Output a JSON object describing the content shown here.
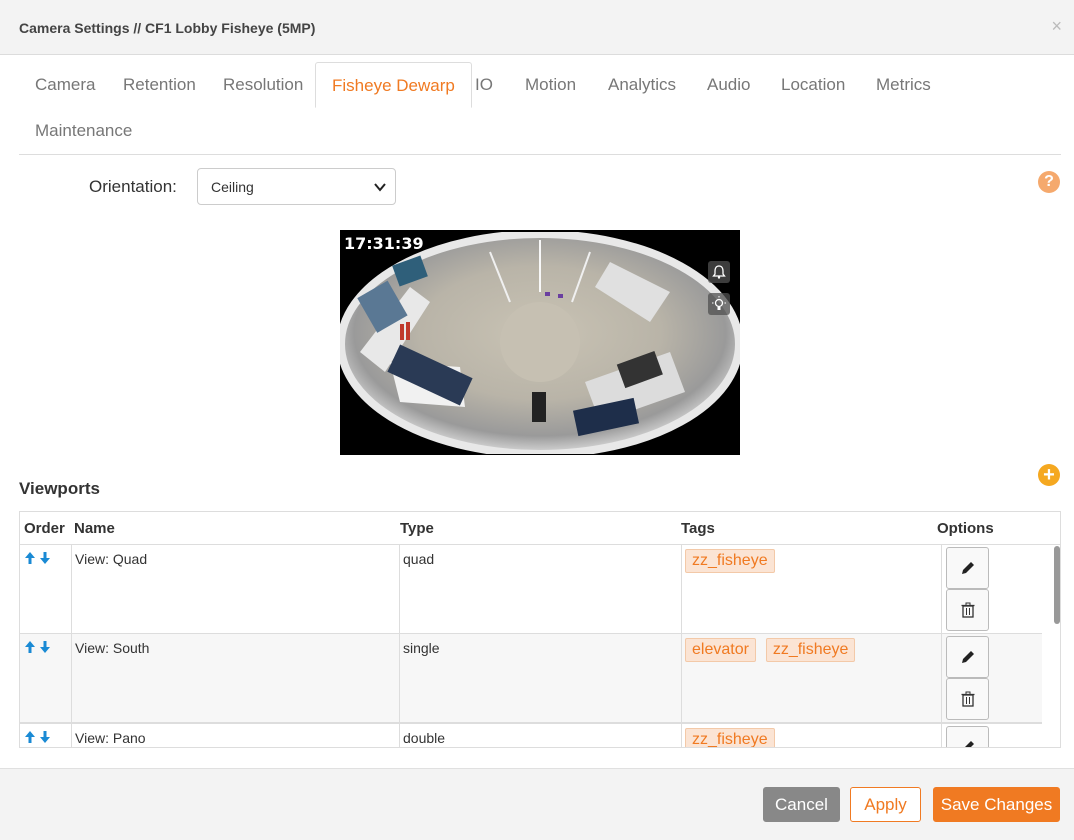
{
  "dialog": {
    "title": "Camera Settings // CF1 Lobby Fisheye (5MP)",
    "close_glyph": "×"
  },
  "tabs": [
    {
      "label": "Camera"
    },
    {
      "label": "Retention"
    },
    {
      "label": "Resolution"
    },
    {
      "label": "Fisheye Dewarp",
      "active": true
    },
    {
      "label": "IO"
    },
    {
      "label": "Motion"
    },
    {
      "label": "Analytics"
    },
    {
      "label": "Audio"
    },
    {
      "label": "Location"
    },
    {
      "label": "Metrics"
    },
    {
      "label": "Maintenance"
    }
  ],
  "orientation": {
    "label": "Orientation:",
    "value": "Ceiling"
  },
  "help_glyph": "?",
  "preview": {
    "timestamp": "17:31:39"
  },
  "viewports": {
    "title": "Viewports",
    "add_glyph": "+",
    "columns": {
      "order": "Order",
      "name": "Name",
      "type": "Type",
      "tags": "Tags",
      "options": "Options"
    },
    "rows": [
      {
        "name": "View: Quad",
        "type": "quad",
        "tags": [
          "zz_fisheye"
        ]
      },
      {
        "name": "View: South",
        "type": "single",
        "tags": [
          "elevator",
          "zz_fisheye"
        ]
      },
      {
        "name": "View: Pano",
        "type": "double",
        "tags": [
          "zz_fisheye"
        ]
      }
    ]
  },
  "footer": {
    "cancel": "Cancel",
    "apply": "Apply",
    "save": "Save Changes"
  },
  "colors": {
    "accent": "#f07a22",
    "arrow": "#1a8ad4",
    "tag_bg": "#fbe4d4"
  }
}
